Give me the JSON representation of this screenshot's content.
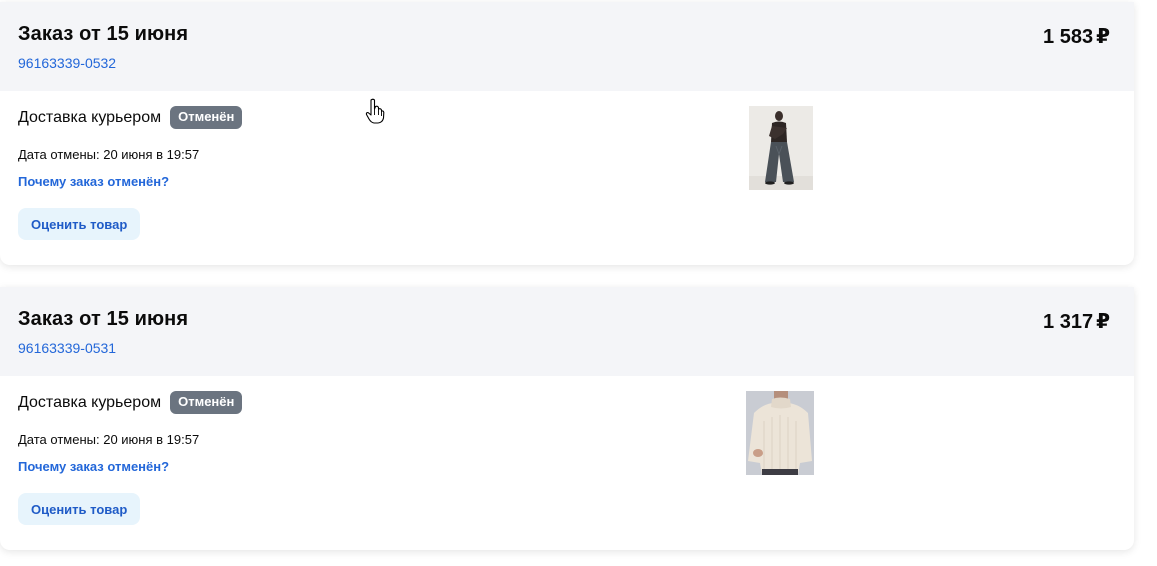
{
  "orders": [
    {
      "title": "Заказ от 15 июня",
      "number": "96163339-0532",
      "price": "1 583",
      "currency": "₽",
      "delivery": "Доставка курьером",
      "status": "Отменён",
      "cancel_date": "Дата отмены: 20 июня в 19:57",
      "why_link": "Почему заказ отменён?",
      "rate_button": "Оценить товар",
      "product_icon": "product-photo-wide-leg-jeans"
    },
    {
      "title": "Заказ от 15 июня",
      "number": "96163339-0531",
      "price": "1 317",
      "currency": "₽",
      "delivery": "Доставка курьером",
      "status": "Отменён",
      "cancel_date": "Дата отмены: 20 июня в 19:57",
      "why_link": "Почему заказ отменён?",
      "rate_button": "Оценить товар",
      "product_icon": "product-photo-beige-sweater"
    }
  ],
  "colors": {
    "header_bg": "#f4f5f8",
    "link": "#2367d9",
    "badge_bg": "#6b7480",
    "button_bg": "#e7f4fc"
  }
}
